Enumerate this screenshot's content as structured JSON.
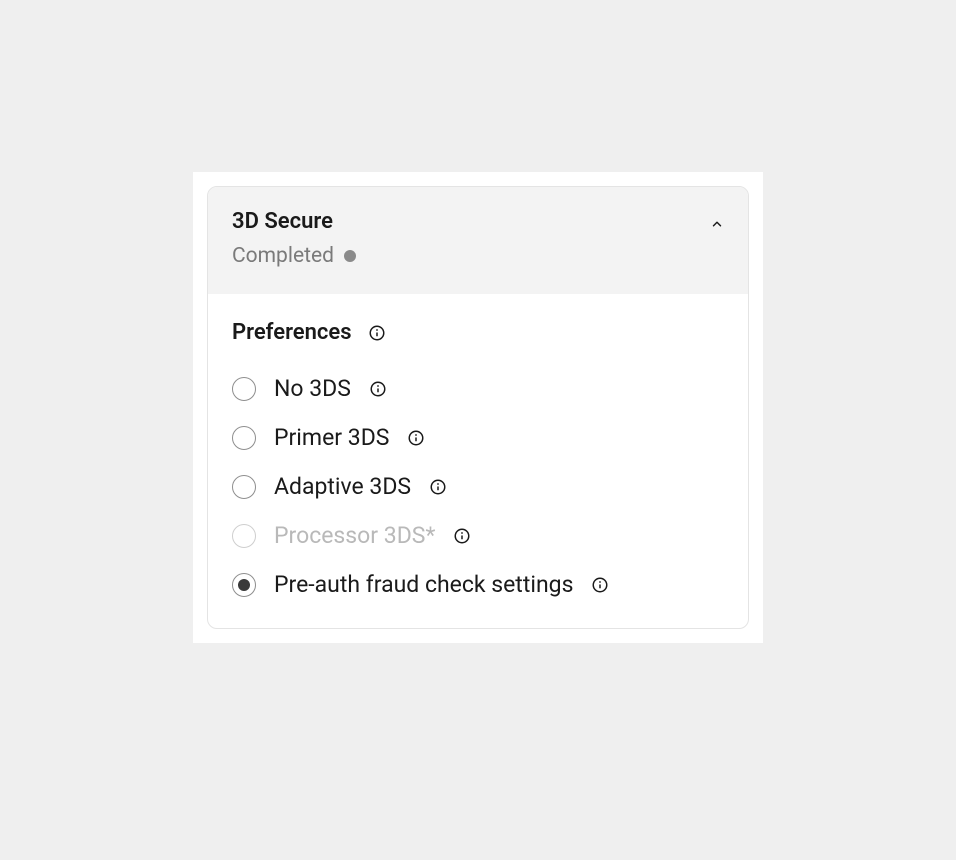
{
  "card": {
    "title": "3D Secure",
    "status": "Completed"
  },
  "preferences": {
    "heading": "Preferences",
    "options": [
      {
        "label": "No 3DS",
        "selected": false,
        "disabled": false
      },
      {
        "label": "Primer 3DS",
        "selected": false,
        "disabled": false
      },
      {
        "label": "Adaptive 3DS",
        "selected": false,
        "disabled": false
      },
      {
        "label": "Processor 3DS*",
        "selected": false,
        "disabled": true
      },
      {
        "label": "Pre-auth fraud check settings",
        "selected": true,
        "disabled": false
      }
    ]
  }
}
